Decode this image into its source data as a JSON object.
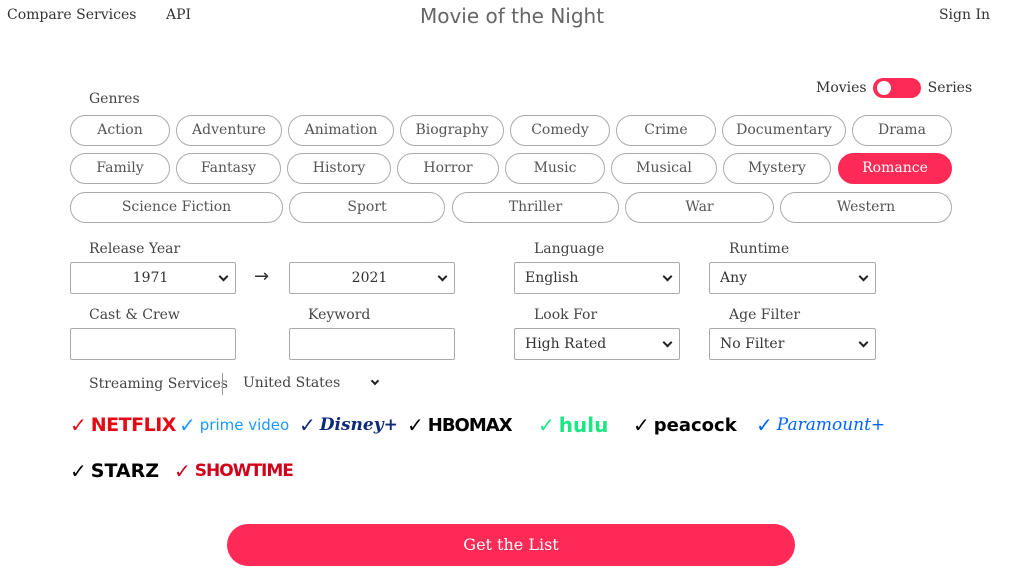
{
  "nav": {
    "compare": "Compare Services",
    "api": "API",
    "title": "Movie of the Night",
    "signin": "Sign In"
  },
  "type_toggle": {
    "left": "Movies",
    "right": "Series",
    "state": "movies"
  },
  "genres_label": "Genres",
  "genres": [
    "Action",
    "Adventure",
    "Animation",
    "Biography",
    "Comedy",
    "Crime",
    "Documentary",
    "Drama",
    "Family",
    "Fantasy",
    "History",
    "Horror",
    "Music",
    "Musical",
    "Mystery",
    "Romance",
    "Science Fiction",
    "Sport",
    "Thriller",
    "War",
    "Western"
  ],
  "selected_genre": "Romance",
  "release_year": {
    "label": "Release Year",
    "from": "1971",
    "to": "2021"
  },
  "language": {
    "label": "Language",
    "value": "English"
  },
  "runtime": {
    "label": "Runtime",
    "value": "Any"
  },
  "cast_crew": {
    "label": "Cast & Crew",
    "value": ""
  },
  "keyword": {
    "label": "Keyword",
    "value": ""
  },
  "look_for": {
    "label": "Look For",
    "value": "High Rated"
  },
  "age_filter": {
    "label": "Age Filter",
    "value": "No Filter"
  },
  "streaming": {
    "label": "Streaming Services",
    "country": "United States"
  },
  "services": [
    {
      "name": "NETFLIX",
      "checked": true,
      "check_color": "#e50914",
      "logo_color": "#e50914"
    },
    {
      "name": "prime video",
      "checked": true,
      "check_color": "#1a98ff",
      "logo_color": "#1a98ff"
    },
    {
      "name": "Disney+",
      "checked": true,
      "check_color": "#0e2a7a",
      "logo_color": "#0e2a7a"
    },
    {
      "name": "HBOMAX",
      "checked": true,
      "check_color": "#000000",
      "logo_color": "#000000"
    },
    {
      "name": "hulu",
      "checked": true,
      "check_color": "#1ce783",
      "logo_color": "#1ce783"
    },
    {
      "name": "peacock",
      "checked": true,
      "check_color": "#000000",
      "logo_color": "#000000"
    },
    {
      "name": "Paramount+",
      "checked": true,
      "check_color": "#0064ff",
      "logo_color": "#0064ff"
    },
    {
      "name": "STARZ",
      "checked": true,
      "check_color": "#000000",
      "logo_color": "#000000"
    },
    {
      "name": "SHOWTIME",
      "checked": true,
      "check_color": "#d0021b",
      "logo_color": "#d0021b"
    }
  ],
  "cta": "Get the List",
  "colors": {
    "accent": "#ff2a55"
  }
}
